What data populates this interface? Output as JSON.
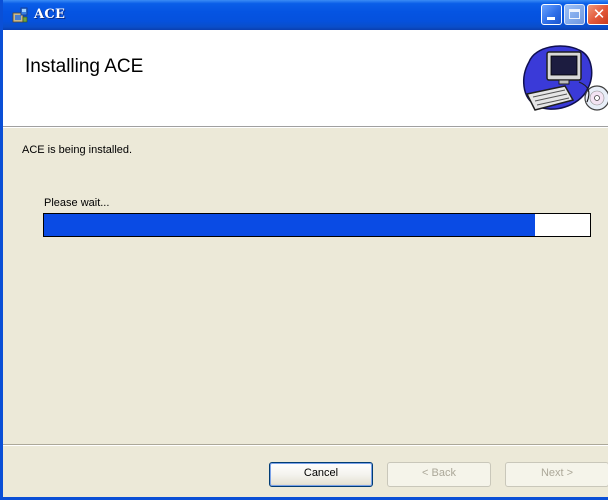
{
  "window": {
    "title": "ACE"
  },
  "header": {
    "title": "Installing ACE",
    "graphic_icon": "computer-installer-icon"
  },
  "body": {
    "status": "ACE is being installed.",
    "progress_label": "Please wait...",
    "progress_percent": 90
  },
  "buttons": {
    "cancel": "Cancel",
    "back": "< Back",
    "next": "Next >"
  },
  "colors": {
    "titlebar": "#0554e2",
    "progress_fill": "#0a4be4",
    "dialog_bg": "#ece9d8"
  }
}
